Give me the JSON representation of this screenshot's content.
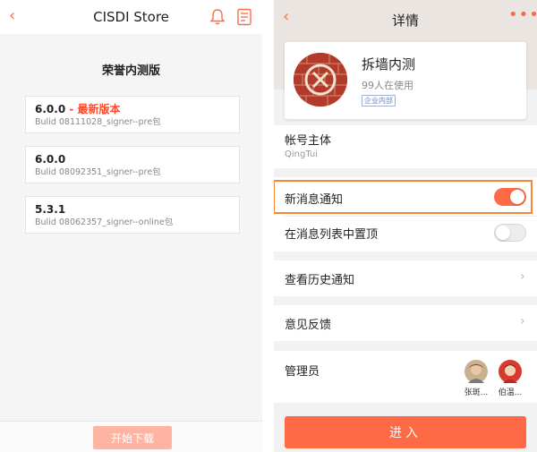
{
  "left": {
    "header": {
      "back_icon": "chevron-left-icon",
      "title": "CISDI Store",
      "bell_icon": "bell-icon",
      "doc_icon": "document-icon"
    },
    "section_title": "荣誉内测版",
    "versions": [
      {
        "version": "6.0.0",
        "tag": " - 最新版本",
        "build": "Bulid 08111028_signer--pre包"
      },
      {
        "version": "6.0.0",
        "tag": "",
        "build": "Bulid 08092351_signer--pre包"
      },
      {
        "version": "5.3.1",
        "tag": "",
        "build": "Bulid 08062357_signer--online包"
      }
    ],
    "download_label": "开始下载"
  },
  "right": {
    "header": {
      "back_icon": "chevron-left-icon",
      "title": "详情",
      "more_icon": "more-dots-icon"
    },
    "app": {
      "name": "拆墙内测",
      "users": "99人在使用",
      "badge": "企业内部"
    },
    "owner": {
      "label": "帐号主体",
      "value": "QingTui"
    },
    "settings": {
      "new_message_notify": {
        "label": "新消息通知",
        "enabled": true
      },
      "pin_top": {
        "label": "在消息列表中置顶",
        "enabled": false
      }
    },
    "history_label": "查看历史通知",
    "feedback_label": "意见反馈",
    "admins": {
      "label": "管理员",
      "people": [
        {
          "name": "张斑..."
        },
        {
          "name": "伯温..."
        }
      ]
    },
    "enter_label": "进入"
  },
  "colors": {
    "accent": "#ff6a46",
    "highlight": "#f7883a",
    "download_disabled": "#ffb3a3"
  }
}
